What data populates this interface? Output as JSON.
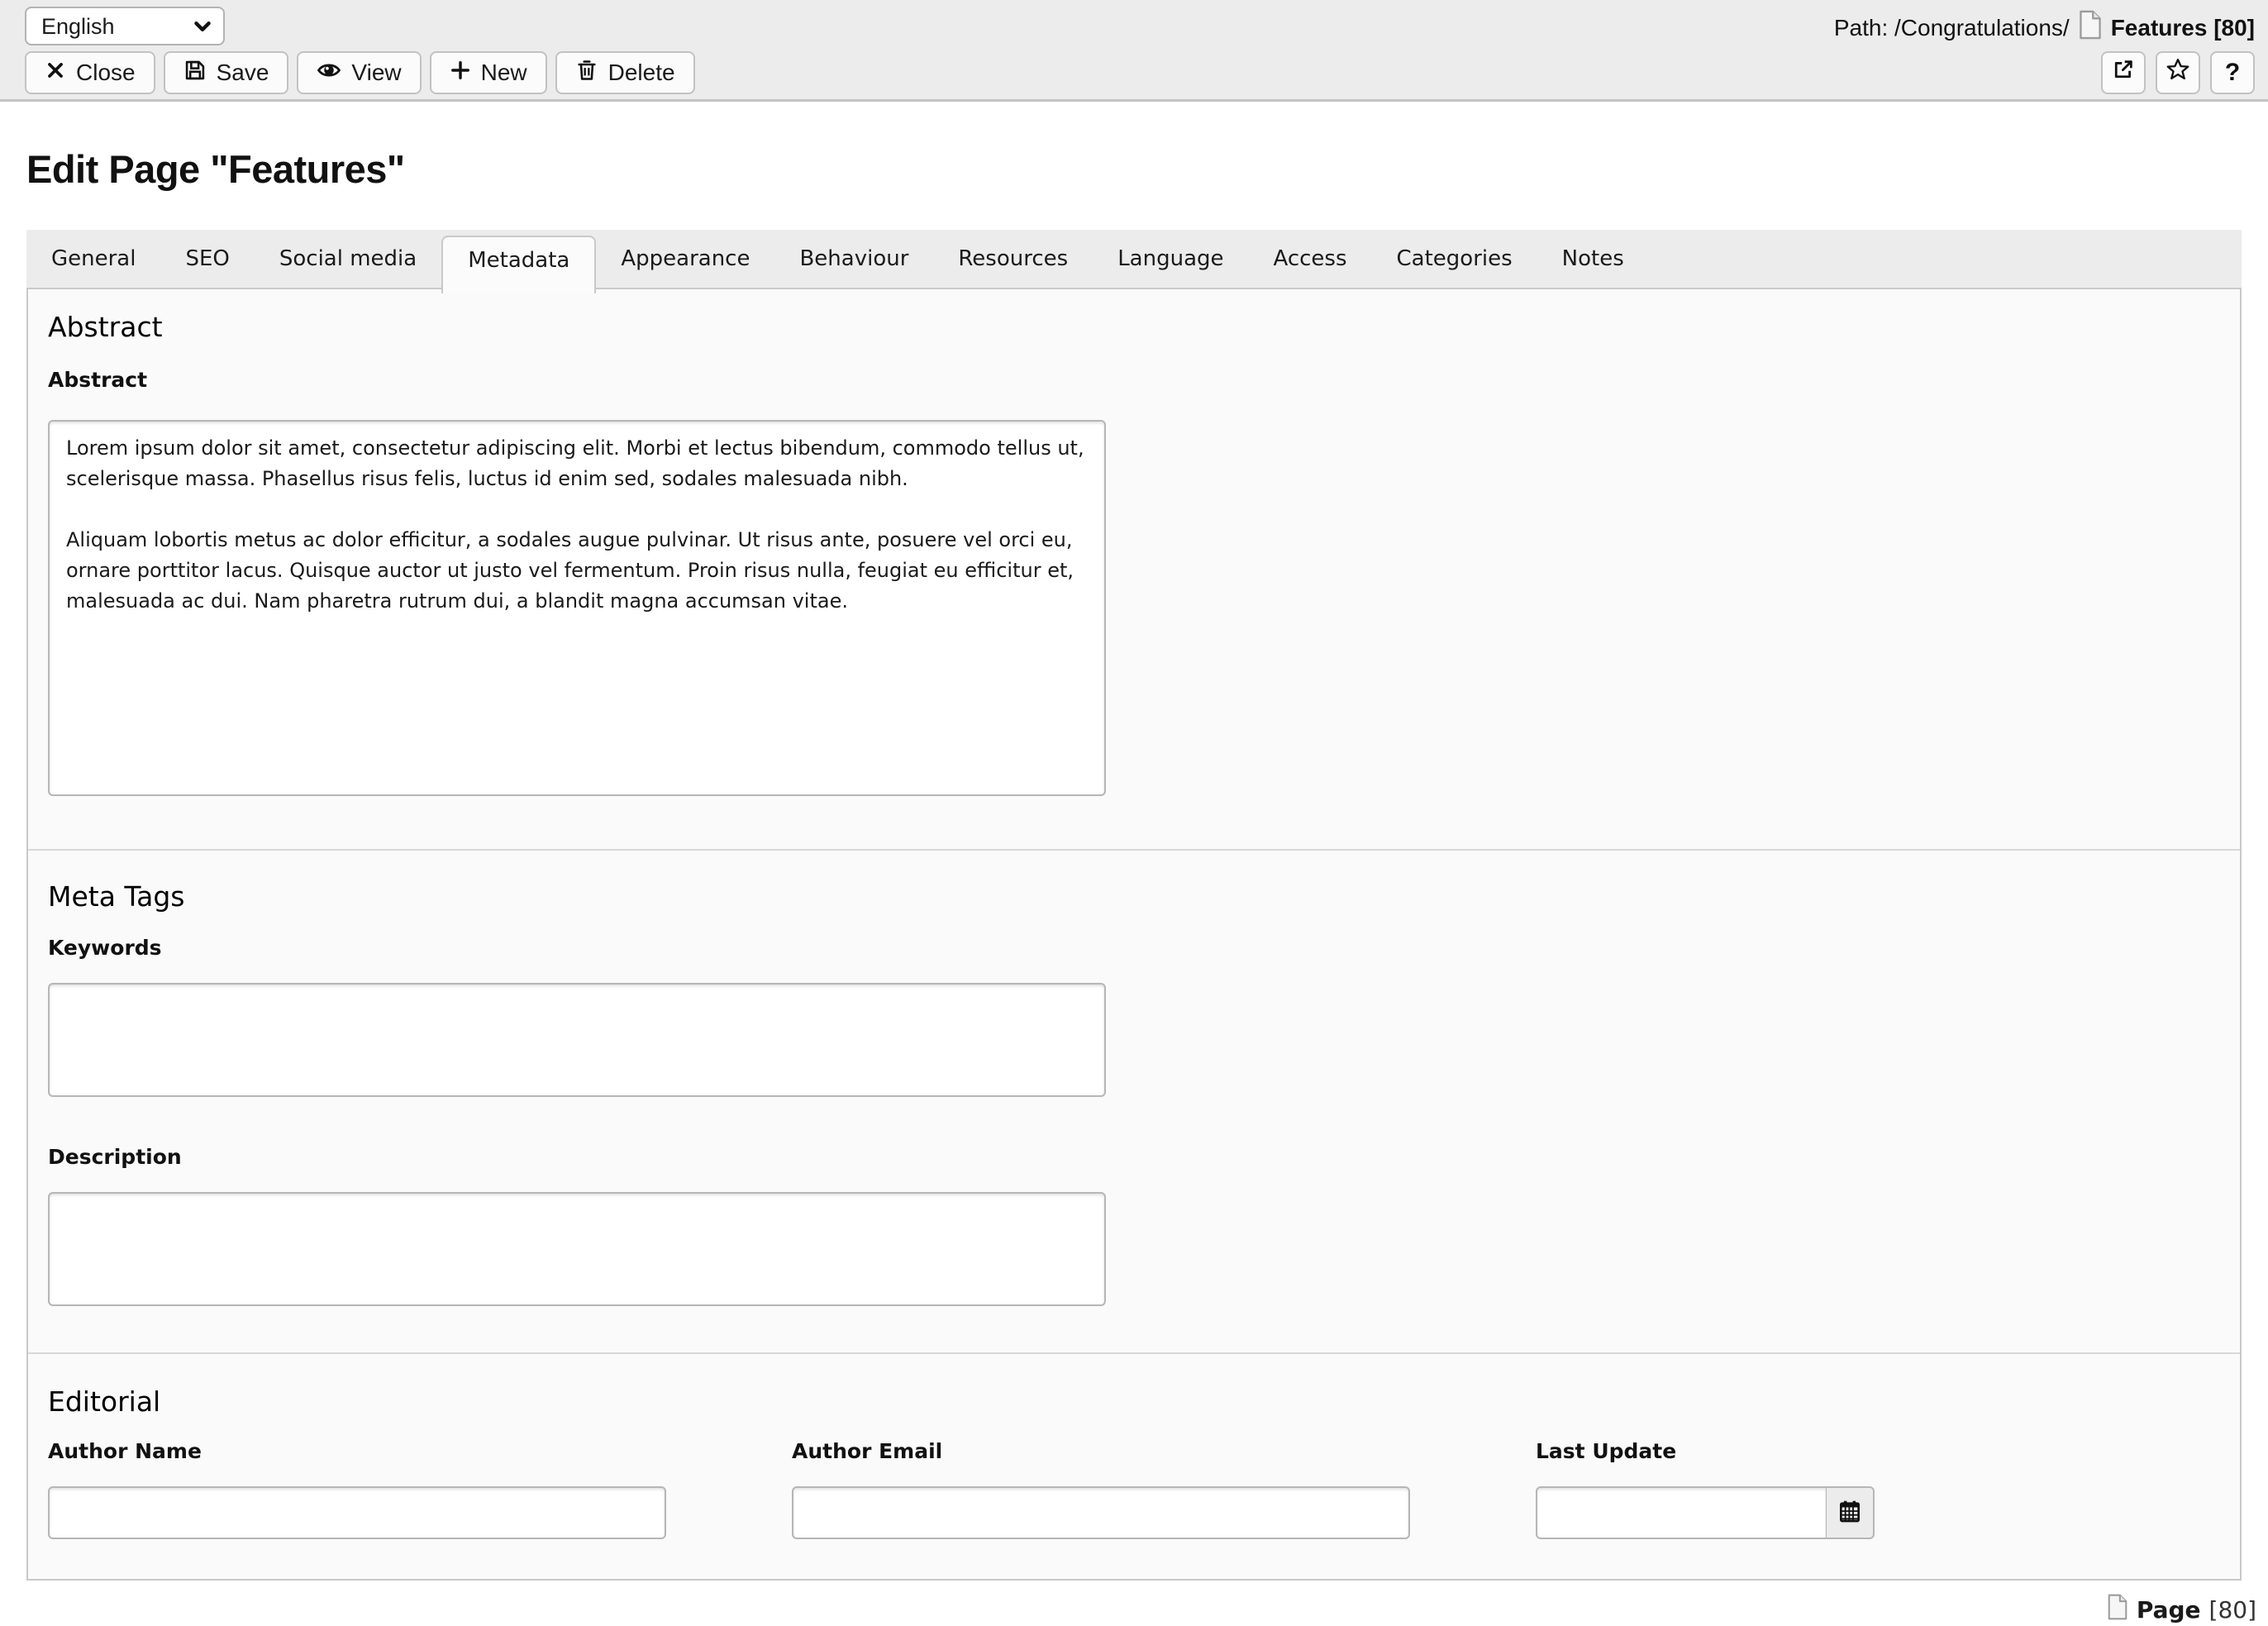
{
  "topbar": {
    "language_select": {
      "value": "English"
    },
    "buttons": [
      {
        "label": "Close"
      },
      {
        "label": "Save"
      },
      {
        "label": "View"
      },
      {
        "label": "New"
      },
      {
        "label": "Delete"
      }
    ],
    "path_label": "Path: /Congratulations/",
    "record_title": "Features [80]",
    "help_glyph": "?"
  },
  "page": {
    "title": "Edit Page \"Features\""
  },
  "tabs": {
    "active": "Metadata",
    "items": [
      {
        "label": "General"
      },
      {
        "label": "SEO"
      },
      {
        "label": "Social media"
      },
      {
        "label": "Metadata"
      },
      {
        "label": "Appearance"
      },
      {
        "label": "Behaviour"
      },
      {
        "label": "Resources"
      },
      {
        "label": "Language"
      },
      {
        "label": "Access"
      },
      {
        "label": "Categories"
      },
      {
        "label": "Notes"
      }
    ]
  },
  "sections": {
    "abstract": {
      "title": "Abstract",
      "abstract_field": {
        "label": "Abstract",
        "value": "Lorem ipsum dolor sit amet, consectetur adipiscing elit. Morbi et lectus bibendum, commodo tellus ut, scelerisque massa. Phasellus risus felis, luctus id enim sed, sodales malesuada nibh.\n\nAliquam lobortis metus ac dolor efficitur, a sodales augue pulvinar. Ut risus ante, posuere vel orci eu, ornare porttitor lacus. Quisque auctor ut justo vel fermentum. Proin risus nulla, feugiat eu efficitur et, malesuada ac dui. Nam pharetra rutrum dui, a blandit magna accumsan vitae."
      }
    },
    "meta_tags": {
      "title": "Meta Tags",
      "keywords": {
        "label": "Keywords",
        "value": ""
      },
      "description": {
        "label": "Description",
        "value": ""
      }
    },
    "editorial": {
      "title": "Editorial",
      "author_name": {
        "label": "Author Name",
        "value": ""
      },
      "author_email": {
        "label": "Author Email",
        "value": ""
      },
      "last_update": {
        "label": "Last Update",
        "value": ""
      }
    }
  },
  "footer": {
    "record_type": "Page",
    "record_id": "[80]"
  },
  "colors": {
    "topbar_bg": "#ececec",
    "panel_bg": "#fafafa",
    "border": "#c9c9c9",
    "control_border": "#b6b6b6"
  }
}
